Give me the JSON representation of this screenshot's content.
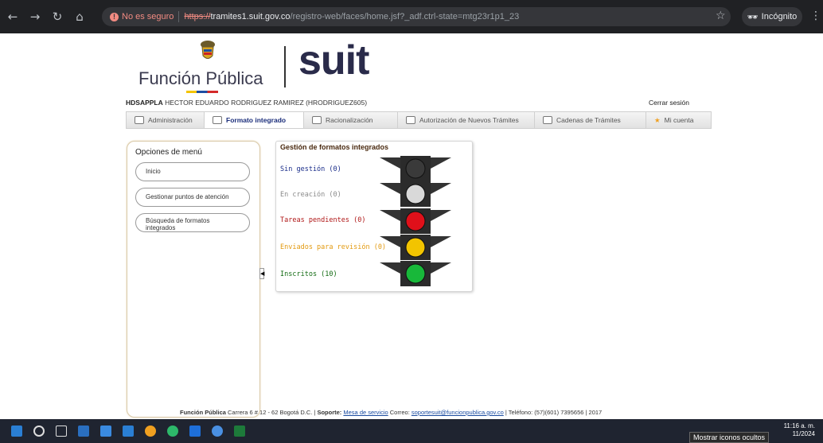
{
  "browser": {
    "security_label": "No es seguro",
    "url_scheme": "https://",
    "url_host": "tramites1.suit.gov.co",
    "url_rest": "/registro-web/faces/home.jsf?_adf.ctrl-state=mtg23r1p1_23",
    "incognito_label": "Incógnito"
  },
  "header": {
    "brand_left": "Función Pública",
    "brand_right": "suit"
  },
  "user": {
    "code": "HDSAPPLA",
    "name": "HECTOR EDUARDO RODRIGUEZ RAMIREZ (HRODRIGUEZ605)",
    "logout": "Cerrar sesión"
  },
  "tabs": [
    {
      "label": "Administración",
      "icon": "admin-icon"
    },
    {
      "label": "Formato integrado",
      "icon": "form-icon",
      "active": true
    },
    {
      "label": "Racionalización",
      "icon": "edit-icon"
    },
    {
      "label": "Autorización de Nuevos Trámites",
      "icon": "doc-icon"
    },
    {
      "label": "Cadenas de Trámites",
      "icon": "chain-icon"
    },
    {
      "label": "Mi cuenta",
      "icon": "star-icon"
    }
  ],
  "menu": {
    "title": "Opciones de menú",
    "items": [
      "Inicio",
      "Gestionar puntos de atención",
      "Búsqueda de formatos integrados"
    ]
  },
  "gestion": {
    "title": "Gestión de formatos integrados",
    "statuses": [
      {
        "label": "Sin gestión (0)",
        "color": "#1a2d8a",
        "light": "#3a3a3a"
      },
      {
        "label": "En creación (0)",
        "color": "#8a8a8a",
        "light": "#d9d9d9"
      },
      {
        "label": "Tareas pendientes (0)",
        "color": "#b01818",
        "light": "#e0101a"
      },
      {
        "label": "Enviados para revisión (0)",
        "color": "#e39a10",
        "light": "#f2c400"
      },
      {
        "label": "Inscritos (10)",
        "color": "#126b12",
        "light": "#18b83a"
      }
    ]
  },
  "footer": {
    "org": "Función Pública",
    "address": "Carrera 6 # 12 - 62 Bogotá D.C. |",
    "support_label": "Soporte:",
    "support_link": "Mesa de servicio",
    "email_label": "Correo:",
    "email": "soportesuit@funcionpublica.gov.co",
    "phone": "| Teléfono: (57)(601) 7395656 | 2017"
  },
  "taskbar": {
    "time": "11:16 a. m.",
    "date": "11/2024",
    "tooltip": "Mostrar iconos ocultos"
  }
}
